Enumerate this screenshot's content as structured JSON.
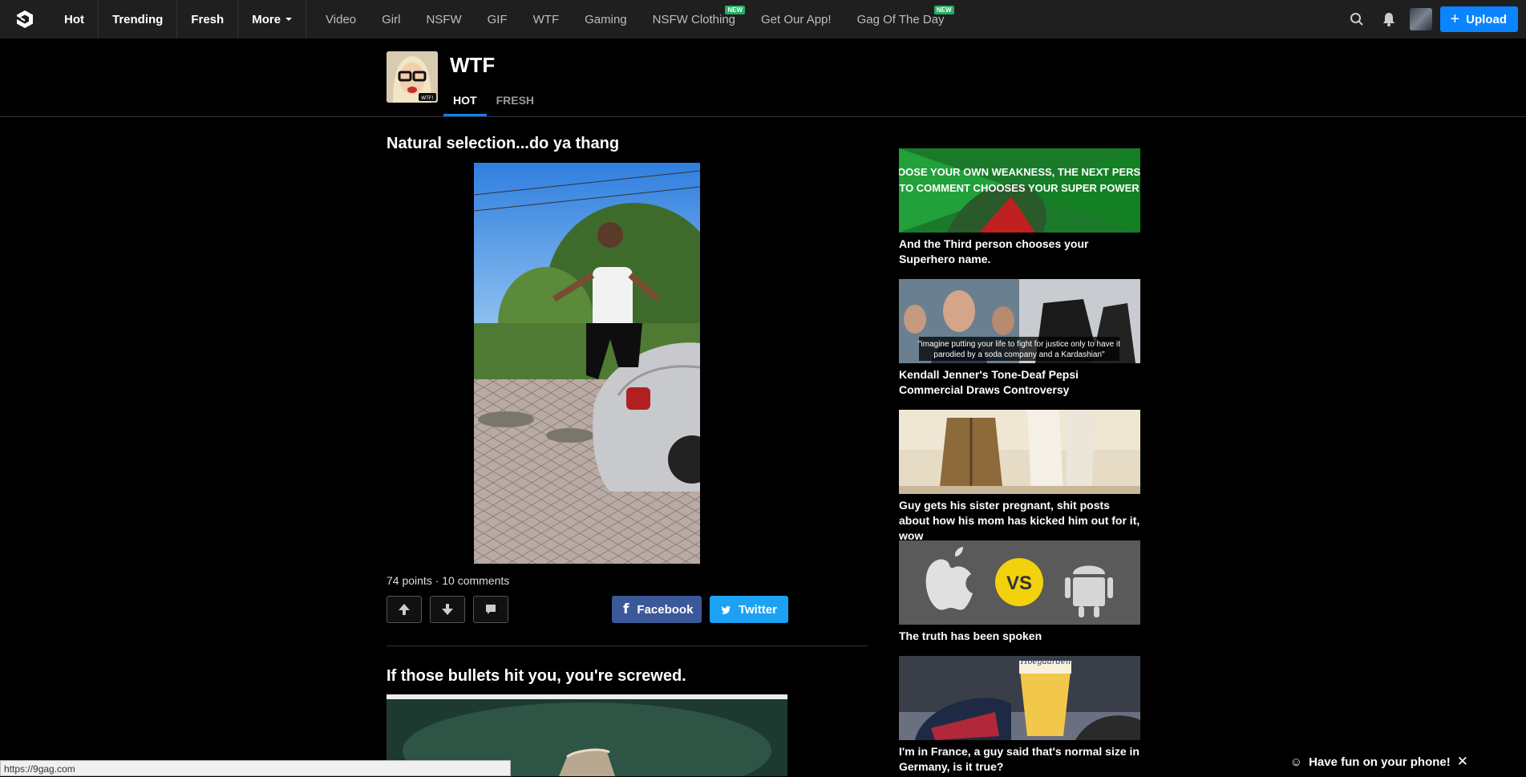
{
  "nav": {
    "main": [
      {
        "label": "Hot"
      },
      {
        "label": "Trending"
      },
      {
        "label": "Fresh"
      },
      {
        "label": "More"
      }
    ],
    "secondary": [
      {
        "label": "Video",
        "new": ""
      },
      {
        "label": "Girl",
        "new": ""
      },
      {
        "label": "NSFW",
        "new": ""
      },
      {
        "label": "GIF",
        "new": ""
      },
      {
        "label": "WTF",
        "new": ""
      },
      {
        "label": "Gaming",
        "new": ""
      },
      {
        "label": "NSFW Clothing",
        "new": "NEW"
      },
      {
        "label": "Get Our App!",
        "new": ""
      },
      {
        "label": "Gag Of The Day",
        "new": "NEW"
      }
    ],
    "upload_label": "Upload",
    "accent": "#0a84ff"
  },
  "section": {
    "title": "WTF",
    "tabs": [
      "HOT",
      "FRESH"
    ]
  },
  "post": {
    "title": "Natural selection...do ya thang",
    "meta": "74 points · 10 comments",
    "facebook_label": "Facebook",
    "twitter_label": "Twitter"
  },
  "post2": {
    "title": "If those bullets hit you, you're screwed."
  },
  "sidebar": [
    {
      "text": "And the Third person chooses your Superhero name.",
      "overlay": "CHOOSE YOUR OWN WEAKNESS, THE NEXT PERSON TO COMMENT CHOOSES YOUR SUPER POWER"
    },
    {
      "text": "Kendall Jenner's Tone-Deaf Pepsi Commercial Draws Controversy",
      "overlay": "\"imagine putting your life to fight for justice only to have it parodied by a soda company and a Kardashian\""
    },
    {
      "text": "Guy gets his sister pregnant, shit posts about how his mom has kicked him out for it, wow",
      "overlay": ""
    },
    {
      "text": "The truth has been spoken",
      "overlay": "VS"
    },
    {
      "text": "I'm in France, a guy said that's normal size in Germany, is it true?",
      "overlay": "Hoegaarden"
    }
  ],
  "status_url": "https://9gag.com",
  "toast": "Have fun on your phone!"
}
